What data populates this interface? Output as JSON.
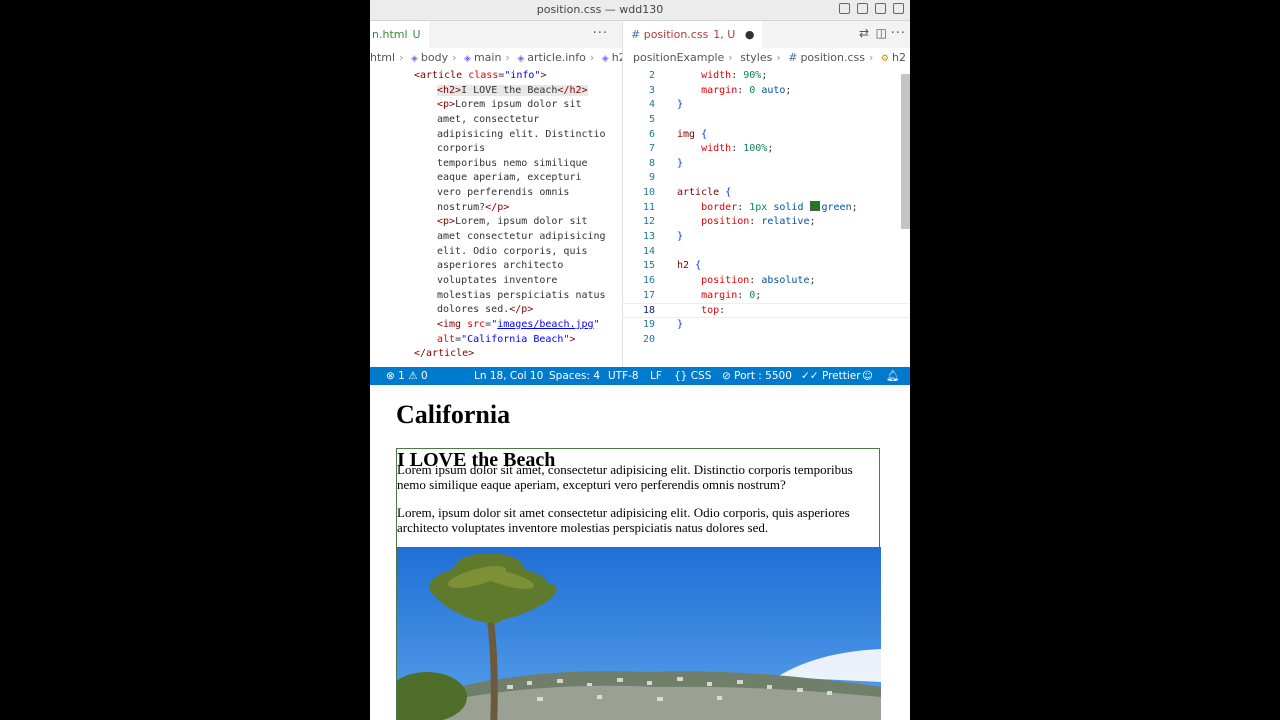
{
  "window": {
    "title": "position.css — wdd130"
  },
  "left_editor": {
    "tab": {
      "label": "n.html",
      "status": "U"
    },
    "more_label": "···",
    "breadcrumbs": [
      "html",
      "body",
      "main",
      "article.info",
      "h2"
    ],
    "lines": [
      [
        [
          "tag",
          "<article "
        ],
        [
          "attr",
          "class"
        ],
        [
          "",
          "="
        ],
        [
          "str",
          "\"info\""
        ],
        [
          "tag",
          ">"
        ]
      ],
      [
        [
          "hltag",
          "<h2>"
        ],
        [
          "hl",
          "I LOVE the Beach"
        ],
        [
          "hltag",
          "</h2>"
        ]
      ],
      [
        [
          "tag",
          "<p>"
        ],
        [
          "",
          "Lorem ipsum dolor sit"
        ]
      ],
      [
        [
          "",
          "amet, consectetur"
        ]
      ],
      [
        [
          "",
          "adipisicing elit. Distinctio"
        ]
      ],
      [
        [
          "",
          "corporis"
        ]
      ],
      [
        [
          "",
          "temporibus nemo similique"
        ]
      ],
      [
        [
          "",
          "eaque aperiam, excepturi"
        ]
      ],
      [
        [
          "",
          "vero perferendis omnis"
        ]
      ],
      [
        [
          "",
          "nostrum?"
        ],
        [
          "tag",
          "</p>"
        ]
      ],
      [
        [
          "tag",
          "<p>"
        ],
        [
          "",
          "Lorem, ipsum dolor sit"
        ]
      ],
      [
        [
          "",
          "amet consectetur adipisicing"
        ]
      ],
      [
        [
          "",
          "elit. Odio corporis, quis"
        ]
      ],
      [
        [
          "",
          "asperiores architecto"
        ]
      ],
      [
        [
          "",
          "voluptates inventore"
        ]
      ],
      [
        [
          "",
          "molestias perspiciatis natus"
        ]
      ],
      [
        [
          "",
          "dolores sed."
        ],
        [
          "tag",
          "</p>"
        ]
      ],
      [
        [
          "tag",
          "<img "
        ],
        [
          "attr",
          "src"
        ],
        [
          "",
          "="
        ],
        [
          "str",
          "\""
        ],
        [
          "link",
          "images/beach.jpg"
        ],
        [
          "str",
          "\""
        ]
      ],
      [
        [
          "attr",
          "alt"
        ],
        [
          "",
          "="
        ],
        [
          "str",
          "\"California Beach\""
        ],
        [
          "tag",
          ">"
        ]
      ],
      [
        [
          "tag",
          "</article>"
        ]
      ]
    ]
  },
  "right_editor": {
    "tab": {
      "label": "position.css",
      "status": "1, U"
    },
    "breadcrumbs": [
      "positionExample",
      "styles",
      "position.css",
      "h2"
    ],
    "lines": [
      {
        "n": "2",
        "parts": [
          [
            "",
            "    "
          ],
          [
            "prop",
            "width"
          ],
          [
            "",
            ": "
          ],
          [
            "num",
            "90%"
          ],
          [
            "",
            ";"
          ]
        ]
      },
      {
        "n": "3",
        "parts": [
          [
            "",
            "    "
          ],
          [
            "prop",
            "margin"
          ],
          [
            "",
            ": "
          ],
          [
            "num",
            "0"
          ],
          [
            "",
            " "
          ],
          [
            "val",
            "auto"
          ],
          [
            "",
            ";"
          ]
        ]
      },
      {
        "n": "4",
        "parts": [
          [
            "brace",
            "}"
          ]
        ]
      },
      {
        "n": "5",
        "parts": []
      },
      {
        "n": "6",
        "parts": [
          [
            "sel",
            "img"
          ],
          [
            "",
            " "
          ],
          [
            "brace",
            "{"
          ]
        ]
      },
      {
        "n": "7",
        "parts": [
          [
            "",
            "    "
          ],
          [
            "prop",
            "width"
          ],
          [
            "",
            ": "
          ],
          [
            "num",
            "100%"
          ],
          [
            "",
            ";"
          ]
        ]
      },
      {
        "n": "8",
        "parts": [
          [
            "brace",
            "}"
          ]
        ]
      },
      {
        "n": "9",
        "parts": []
      },
      {
        "n": "10",
        "parts": [
          [
            "sel",
            "article"
          ],
          [
            "",
            " "
          ],
          [
            "brace",
            "{"
          ]
        ]
      },
      {
        "n": "11",
        "parts": [
          [
            "",
            "    "
          ],
          [
            "prop",
            "border"
          ],
          [
            "",
            ": "
          ],
          [
            "num",
            "1px"
          ],
          [
            "",
            " "
          ],
          [
            "val",
            "solid"
          ],
          [
            "",
            " "
          ],
          [
            "swatch",
            ""
          ],
          [
            "val",
            "green"
          ],
          [
            "",
            ";"
          ]
        ]
      },
      {
        "n": "12",
        "parts": [
          [
            "",
            "    "
          ],
          [
            "prop",
            "position"
          ],
          [
            "",
            ": "
          ],
          [
            "val",
            "relative"
          ],
          [
            "",
            ";"
          ]
        ]
      },
      {
        "n": "13",
        "parts": [
          [
            "brace",
            "}"
          ]
        ]
      },
      {
        "n": "14",
        "parts": []
      },
      {
        "n": "15",
        "parts": [
          [
            "sel",
            "h2"
          ],
          [
            "",
            " "
          ],
          [
            "brace",
            "{"
          ]
        ]
      },
      {
        "n": "16",
        "parts": [
          [
            "",
            "    "
          ],
          [
            "prop",
            "position"
          ],
          [
            "",
            ": "
          ],
          [
            "val",
            "absolute"
          ],
          [
            "",
            ";"
          ]
        ]
      },
      {
        "n": "17",
        "parts": [
          [
            "",
            "    "
          ],
          [
            "prop",
            "margin"
          ],
          [
            "",
            ": "
          ],
          [
            "num",
            "0"
          ],
          [
            "",
            ";"
          ]
        ]
      },
      {
        "n": "18",
        "parts": [
          [
            "",
            "    "
          ],
          [
            "prop",
            "top"
          ],
          [
            "",
            ":"
          ]
        ]
      },
      {
        "n": "19",
        "parts": [
          [
            "brace",
            "}"
          ]
        ]
      },
      {
        "n": "20",
        "parts": []
      }
    ],
    "active_line": "18"
  },
  "statusbar": {
    "problems": "1",
    "warnings": "0",
    "cursor": "Ln 18, Col 10",
    "spaces": "Spaces: 4",
    "encoding": "UTF-8",
    "eol": "LF",
    "language": "CSS",
    "port": "Port : 5500",
    "formatter": "Prettier"
  },
  "preview": {
    "heading": "California",
    "article_heading": "I LOVE the Beach",
    "paragraph1": "Lorem ipsum dolor sit amet, consectetur adipisicing elit. Distinctio corporis temporibus nemo similique eaque aperiam, excepturi vero perferendis omnis nostrum?",
    "paragraph2": "Lorem, ipsum dolor sit amet consectetur adipisicing elit. Odio corporis, quis asperiores architecto voluptates inventore molestias perspiciatis natus dolores sed.",
    "image_alt": "California Beach"
  },
  "colors": {
    "statusbar": "#007acc",
    "html_tab_text": "#3a8a3a",
    "css_tab_text": "#b33a3a",
    "article_border": "#4a7a4a"
  },
  "icons": [
    "split-editor-icon",
    "layout-icon",
    "close-circle-icon",
    "warning-icon",
    "braces-icon",
    "port-icon",
    "check-all-icon",
    "feedback-icon",
    "bell-icon",
    "git-compare-icon"
  ]
}
